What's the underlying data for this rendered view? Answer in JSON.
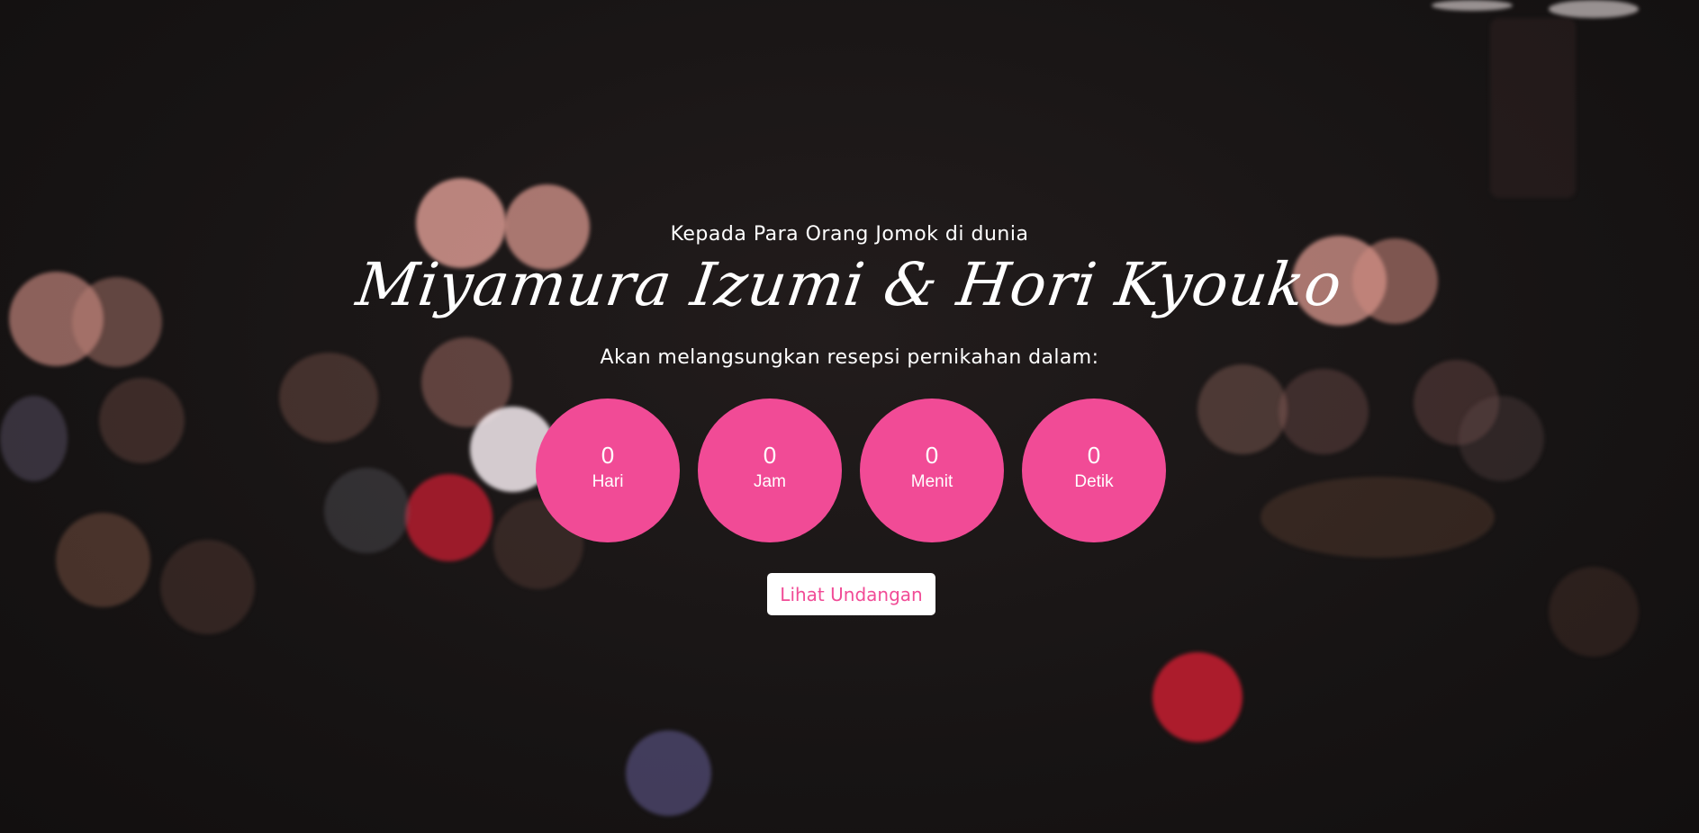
{
  "hero": {
    "greeting": "Kepada Para Orang Jomok di dunia",
    "couple_names": "Miyamura Izumi & Hori Kyouko",
    "subtitle": "Akan melangsungkan resepsi pernikahan dalam:"
  },
  "countdown": {
    "items": [
      {
        "value": "0",
        "label": "Hari"
      },
      {
        "value": "0",
        "label": "Jam"
      },
      {
        "value": "0",
        "label": "Menit"
      },
      {
        "value": "0",
        "label": "Detik"
      }
    ]
  },
  "cta": {
    "label": "Lihat Undangan"
  },
  "colors": {
    "accent": "#f14b96",
    "background": "#171414",
    "text": "#ffffff"
  }
}
